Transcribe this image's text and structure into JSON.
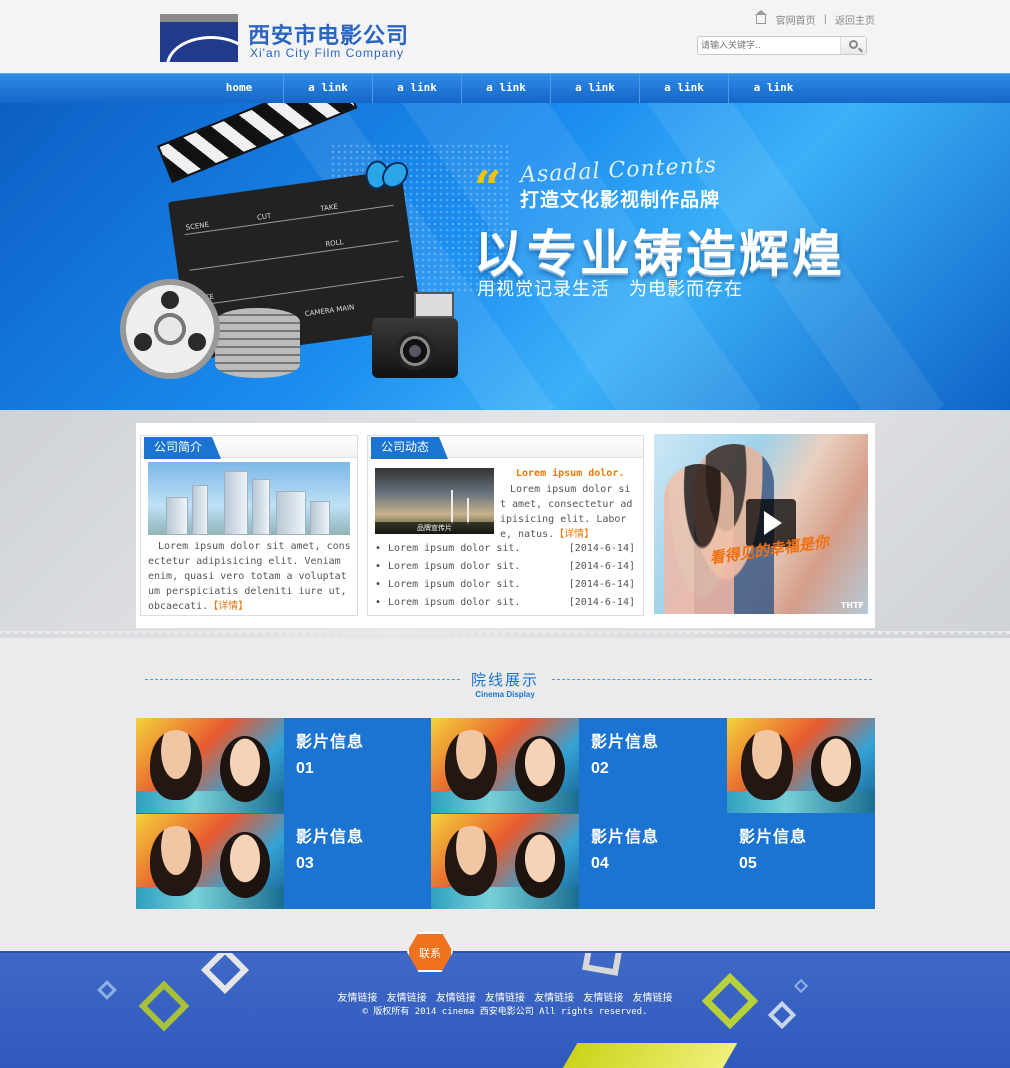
{
  "header": {
    "logo_cn": "西安市电影公司",
    "logo_en": "Xi'an City Film Company",
    "top_links": [
      "官网首页",
      "返回主页"
    ],
    "search_placeholder": "请输入关键字..",
    "icons": [
      "home-icon",
      "search-icon"
    ]
  },
  "nav": {
    "items": [
      "home",
      "a link",
      "a link",
      "a link",
      "a link",
      "a link",
      "a link"
    ]
  },
  "banner": {
    "script": "Asadal Contents",
    "tagline1": "打造文化影视制作品牌",
    "headline": "以专业铸造辉煌",
    "tagline2": "用视觉记录生活　为电影而存在",
    "clapper_labels": [
      "SCENE",
      "CUT",
      "TAKE",
      "ROLL",
      "DATE",
      "CAMERA MAIN"
    ],
    "colors": {
      "banner_blue": "#1b8ef0",
      "quote_yellow": "#f4c400"
    }
  },
  "intro": {
    "tab": "公司简介",
    "text": "　Lorem ipsum dolor sit amet, consectetur adipisicing elit. Veniam enim, quasi vero totam a voluptatum perspiciatis deleniti iure ut, obcaecati.",
    "more": "【详情】"
  },
  "news": {
    "tab": "公司动态",
    "photo_caption": "品牌宣传片",
    "title": "Lorem ipsum dolor.",
    "text": "　Lorem ipsum dolor sit amet, consectetur adipisicing elit. Labore, natus.",
    "more": "【详情】",
    "items": [
      {
        "title": "Lorem ipsum dolor sit.",
        "date": "[2014-6-14]"
      },
      {
        "title": "Lorem ipsum dolor sit.",
        "date": "[2014-6-14]"
      },
      {
        "title": "Lorem ipsum dolor sit.",
        "date": "[2014-6-14]"
      },
      {
        "title": "Lorem ipsum dolor sit.",
        "date": "[2014-6-14]"
      }
    ]
  },
  "video": {
    "overlay_text": "看得见的幸福是你",
    "brand": "THTF",
    "icon": "play-icon"
  },
  "cinema": {
    "title": "院线展示",
    "subtitle": "Cinema Display",
    "cards": [
      {
        "label": "影片信息",
        "num": "01"
      },
      {
        "label": "影片信息",
        "num": "02"
      },
      {
        "label": "影片信息",
        "num": "03"
      },
      {
        "label": "影片信息",
        "num": "04"
      },
      {
        "label": "影片信息",
        "num": "05"
      }
    ]
  },
  "footer": {
    "contact": "联系",
    "links": [
      "友情链接",
      "友情链接",
      "友情链接",
      "友情链接",
      "友情链接",
      "友情链接",
      "友情链接"
    ],
    "copyright": "© 版权所有 2014 cinema 西安电影公司 All rights reserved."
  }
}
